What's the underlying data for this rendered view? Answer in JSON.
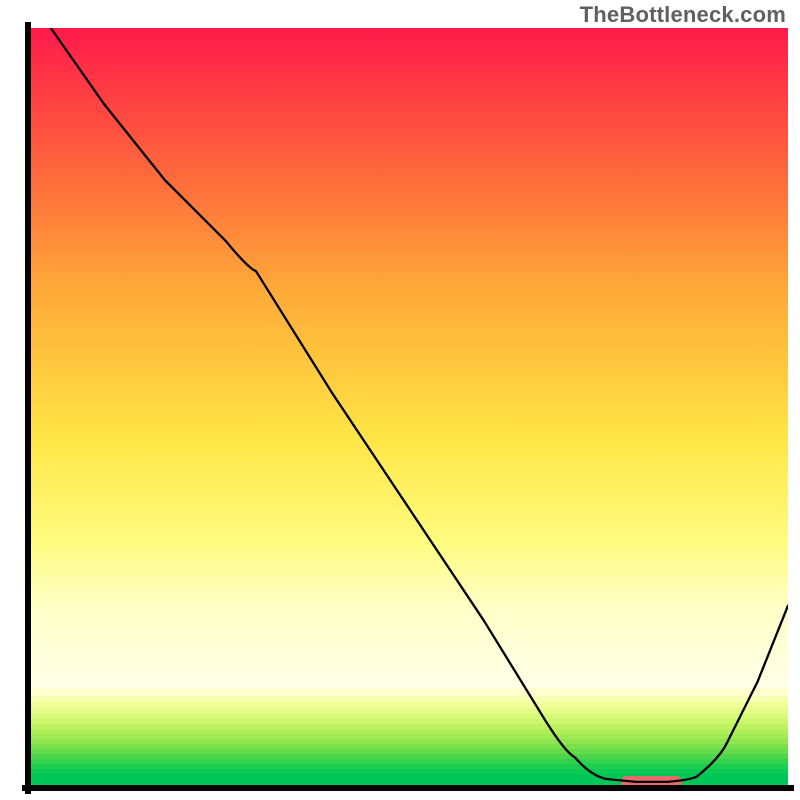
{
  "watermark_text": "TheBottleneck.com",
  "chart_data": {
    "type": "line",
    "title": "",
    "xlabel": "",
    "ylabel": "",
    "xlim": [
      0,
      100
    ],
    "ylim": [
      0,
      100
    ],
    "legend": false,
    "grid": false,
    "background": {
      "description": "vertical gradient red→orange→yellow→pale-yellow→green, with a lower band of horizontal yellow/green stripes transitioning to solid green near y≈0",
      "gradient_stops": [
        {
          "y": 100,
          "color": "#ff1a4b"
        },
        {
          "y": 75,
          "color": "#ff6e3c"
        },
        {
          "y": 50,
          "color": "#ffc23a"
        },
        {
          "y": 28,
          "color": "#fff24a"
        },
        {
          "y": 18,
          "color": "#ffffb0"
        },
        {
          "y": 8,
          "color": "#b8f06a"
        },
        {
          "y": 2,
          "color": "#00e060"
        },
        {
          "y": 0,
          "color": "#00c850"
        }
      ]
    },
    "series": [
      {
        "name": "curve",
        "color": "#000000",
        "stroke_width": 2.3,
        "x": [
          3,
          10,
          18,
          26,
          30,
          40,
          50,
          60,
          68,
          72,
          76,
          80,
          84,
          88,
          92,
          96,
          100
        ],
        "y": [
          100,
          90,
          80,
          72,
          68,
          52,
          37,
          22,
          9,
          4,
          1.2,
          0.8,
          0.8,
          1.5,
          6,
          14,
          24
        ]
      }
    ],
    "marker": {
      "name": "highlight-bar",
      "color": "#e96a6a",
      "shape": "rounded-rect",
      "x_range": [
        78,
        86
      ],
      "y": 0.8,
      "height": 1.4
    },
    "frame": {
      "visible_sides": [
        "left",
        "bottom"
      ],
      "color": "#000000",
      "width": 5
    }
  }
}
